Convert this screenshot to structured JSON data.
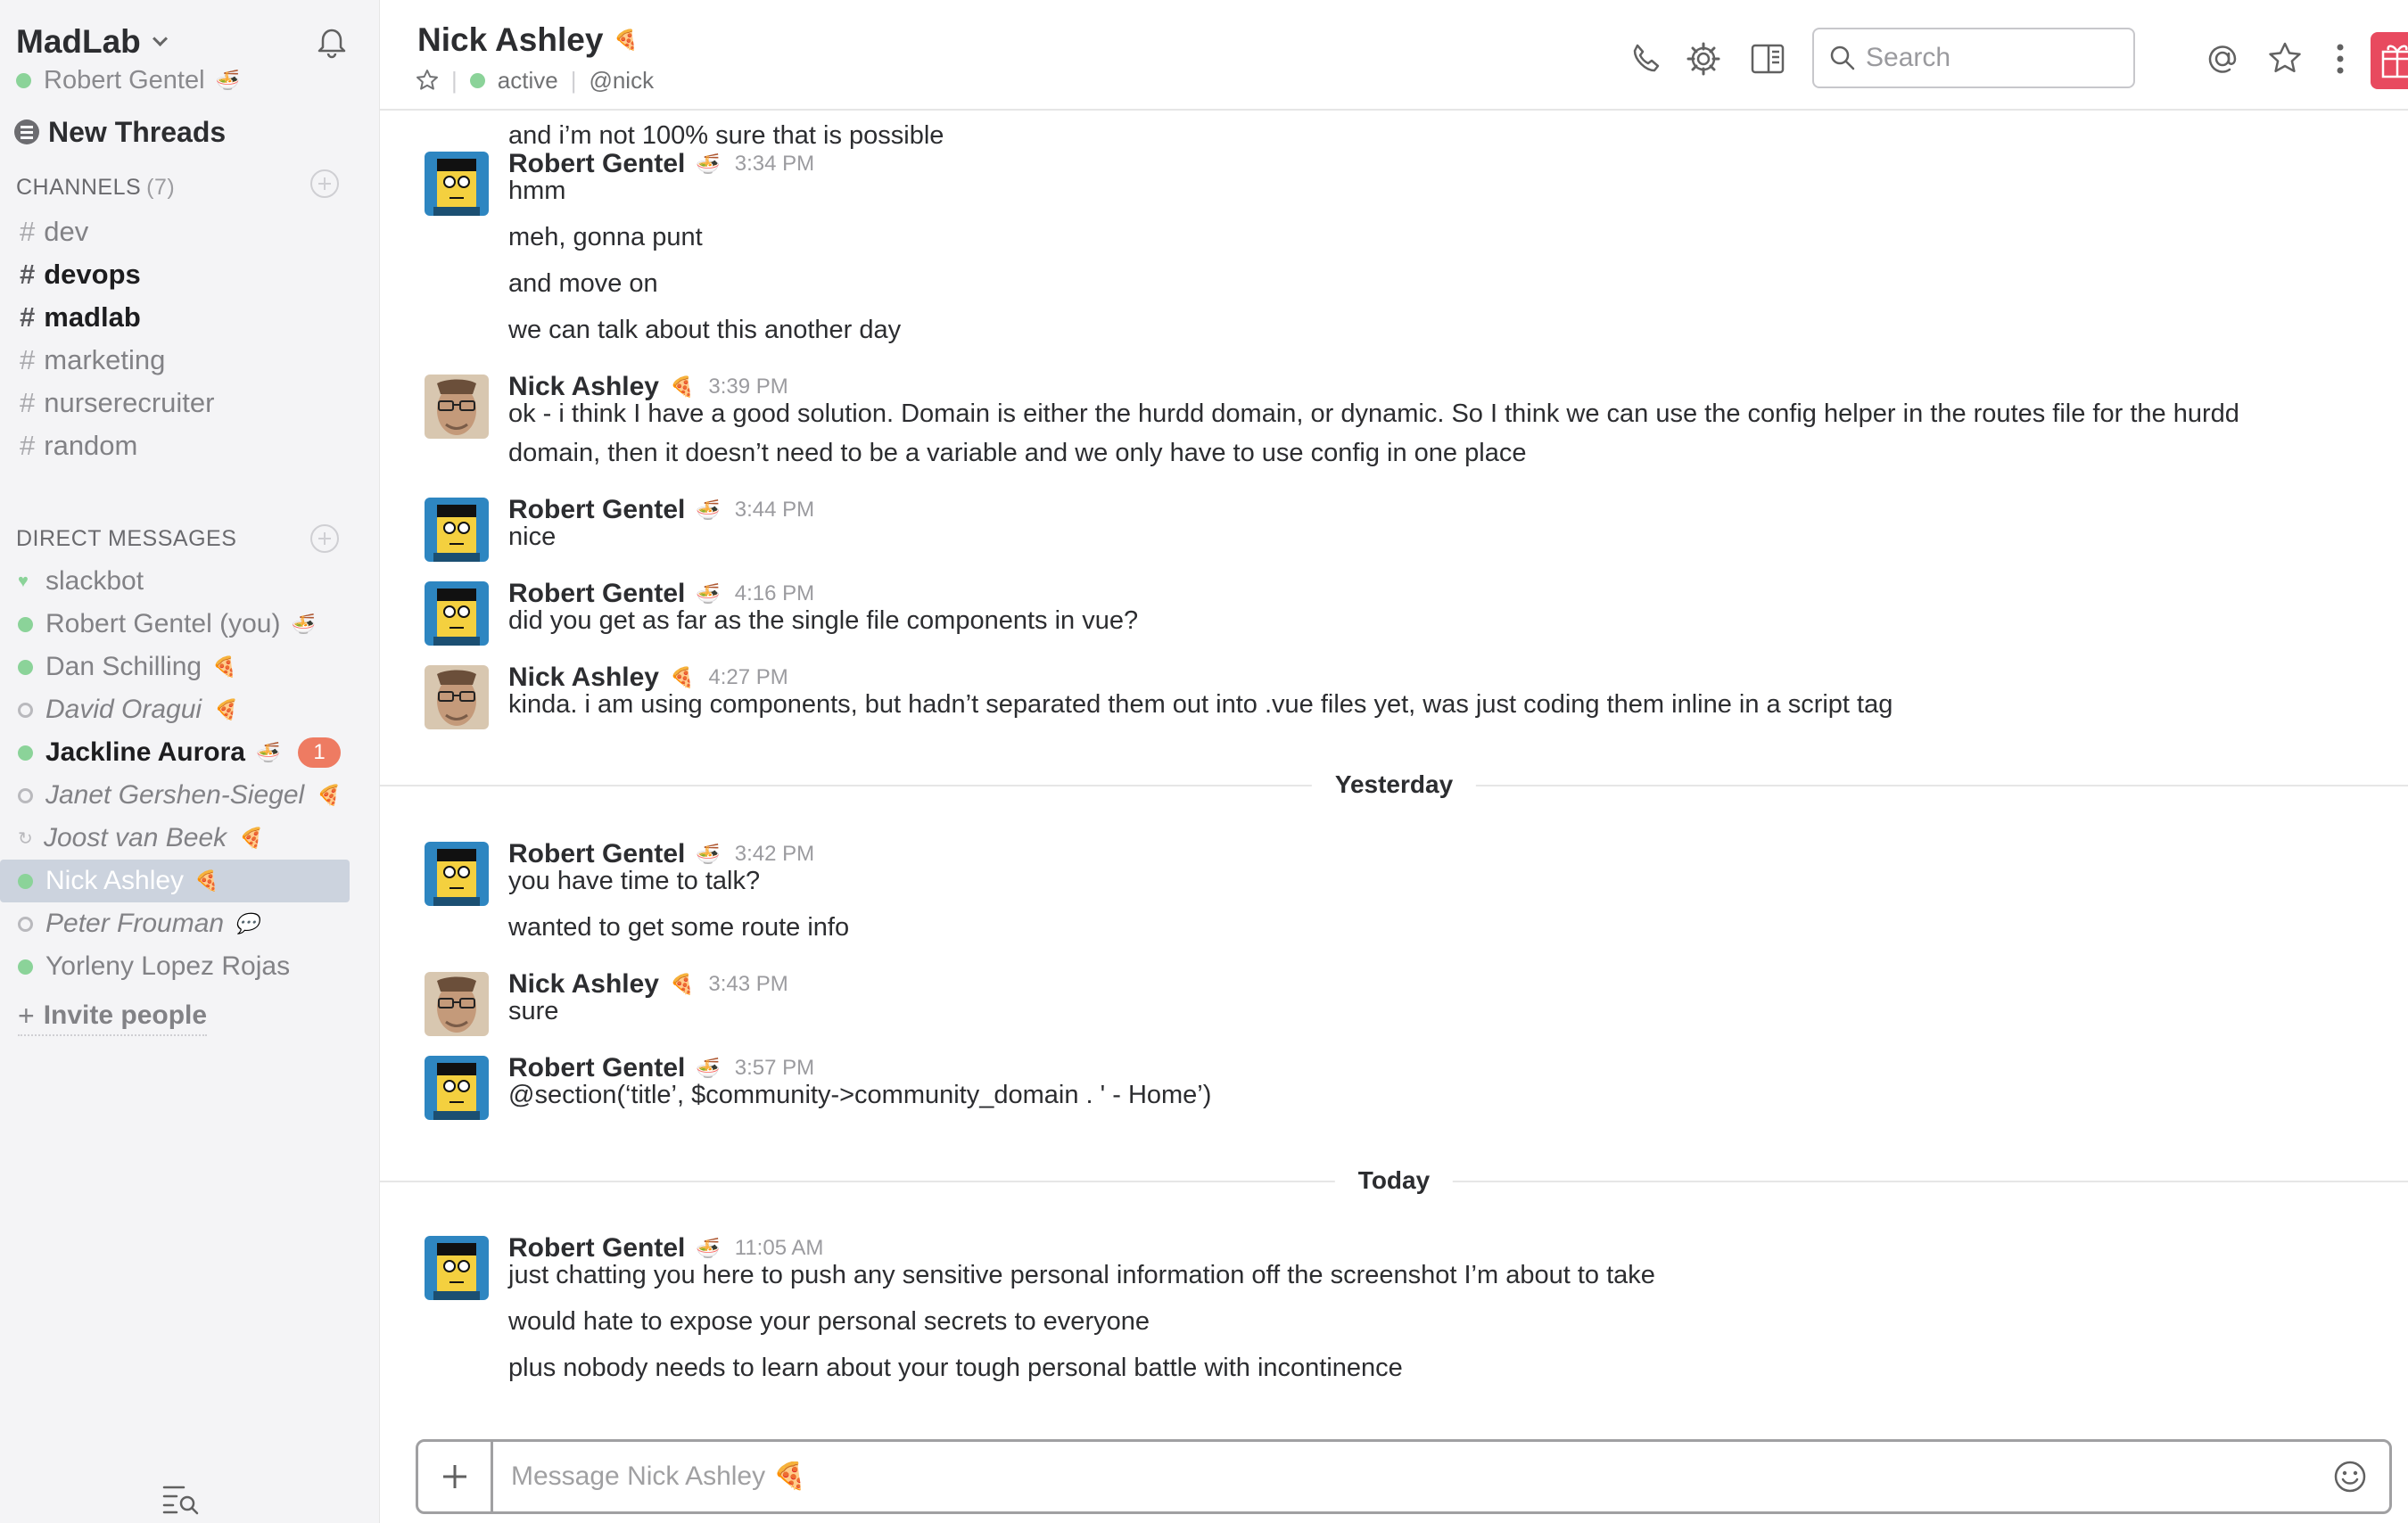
{
  "team": {
    "name": "MadLab",
    "user": "Robert Gentel"
  },
  "sidebar": {
    "new_threads": "New Threads",
    "channels_label": "CHANNELS",
    "channels_count": "(7)",
    "channels": [
      {
        "name": "dev",
        "unread": false
      },
      {
        "name": "devops",
        "unread": true
      },
      {
        "name": "madlab",
        "unread": true
      },
      {
        "name": "marketing",
        "unread": false
      },
      {
        "name": "nurserecruiter",
        "unread": false
      },
      {
        "name": "random",
        "unread": false
      }
    ],
    "dm_label": "DIRECT MESSAGES",
    "dms": [
      {
        "name": "slackbot",
        "status": "bot"
      },
      {
        "name": "Robert Gentel (you)",
        "status": "online",
        "emoji": "🍜"
      },
      {
        "name": "Dan Schilling",
        "status": "online",
        "emoji": "🍕"
      },
      {
        "name": "David Oragui",
        "status": "away",
        "emoji": "🍕"
      },
      {
        "name": "Jackline Aurora",
        "status": "online",
        "emoji": "🍜",
        "unread": true,
        "badge": "1"
      },
      {
        "name": "Janet Gershen-Siegel",
        "status": "away",
        "emoji": "🍕"
      },
      {
        "name": "Joost van Beek",
        "status": "sync",
        "emoji": "🍕"
      },
      {
        "name": "Nick Ashley",
        "status": "online",
        "emoji": "🍕",
        "selected": true
      },
      {
        "name": "Peter Frouman",
        "status": "away",
        "emoji": "💬"
      },
      {
        "name": "Yorleny Lopez Rojas",
        "status": "online"
      }
    ],
    "invite": "Invite people"
  },
  "header": {
    "channel_name": "Nick Ashley",
    "channel_emoji": "🍕",
    "presence": "active",
    "handle": "@nick",
    "search_placeholder": "Search"
  },
  "messages": {
    "top_cont": "and i’m not 100% sure that is possible",
    "m1": {
      "author": "Robert Gentel",
      "emoji": "🍜",
      "time": "3:34 PM",
      "lines": [
        "hmm",
        "meh, gonna punt",
        "and move on",
        "we can talk about this another day"
      ]
    },
    "m2": {
      "author": "Nick Ashley",
      "emoji": "🍕",
      "time": "3:39 PM",
      "lines": [
        "ok - i think I have a good solution. Domain is either the hurdd domain, or dynamic. So I think we can use the config helper in the routes file for the hurdd",
        "domain, then it doesn’t need to be a variable and we only have to use config in one place"
      ]
    },
    "m3": {
      "author": "Robert Gentel",
      "emoji": "🍜",
      "time": "3:44 PM",
      "lines": [
        "nice"
      ]
    },
    "m4": {
      "author": "Robert Gentel",
      "emoji": "🍜",
      "time": "4:16 PM",
      "lines": [
        "did you get as far as the single file components in vue?"
      ]
    },
    "m5": {
      "author": "Nick Ashley",
      "emoji": "🍕",
      "time": "4:27 PM",
      "lines": [
        "kinda. i am using components, but hadn’t separated them out into .vue files yet, was just coding them inline in a script tag"
      ]
    },
    "divider_yesterday": "Yesterday",
    "m6": {
      "author": "Robert Gentel",
      "emoji": "🍜",
      "time": "3:42 PM",
      "lines": [
        "you have time to talk?",
        "wanted to get some route info"
      ]
    },
    "m7": {
      "author": "Nick Ashley",
      "emoji": "🍕",
      "time": "3:43 PM",
      "lines": [
        "sure"
      ]
    },
    "m8": {
      "author": "Robert Gentel",
      "emoji": "🍜",
      "time": "3:57 PM",
      "lines": [
        "@section(‘title’, $community->community_domain . ' - Home’)"
      ]
    },
    "divider_today": "Today",
    "m9": {
      "author": "Robert Gentel",
      "emoji": "🍜",
      "time": "11:05 AM",
      "lines": [
        "just chatting you here to push any sensitive personal information off the screenshot I’m about to take",
        "would hate to expose your personal secrets to everyone",
        "plus nobody needs to learn about your tough personal battle with incontinence"
      ]
    }
  },
  "composer": {
    "placeholder": "Message Nick Ashley 🍕"
  },
  "colors": {
    "sidebar_bg": "#f4f4f6",
    "online": "#8bd399",
    "badge": "#ee7b62",
    "selected": "#ccd3de",
    "gift": "#e84a5f"
  }
}
